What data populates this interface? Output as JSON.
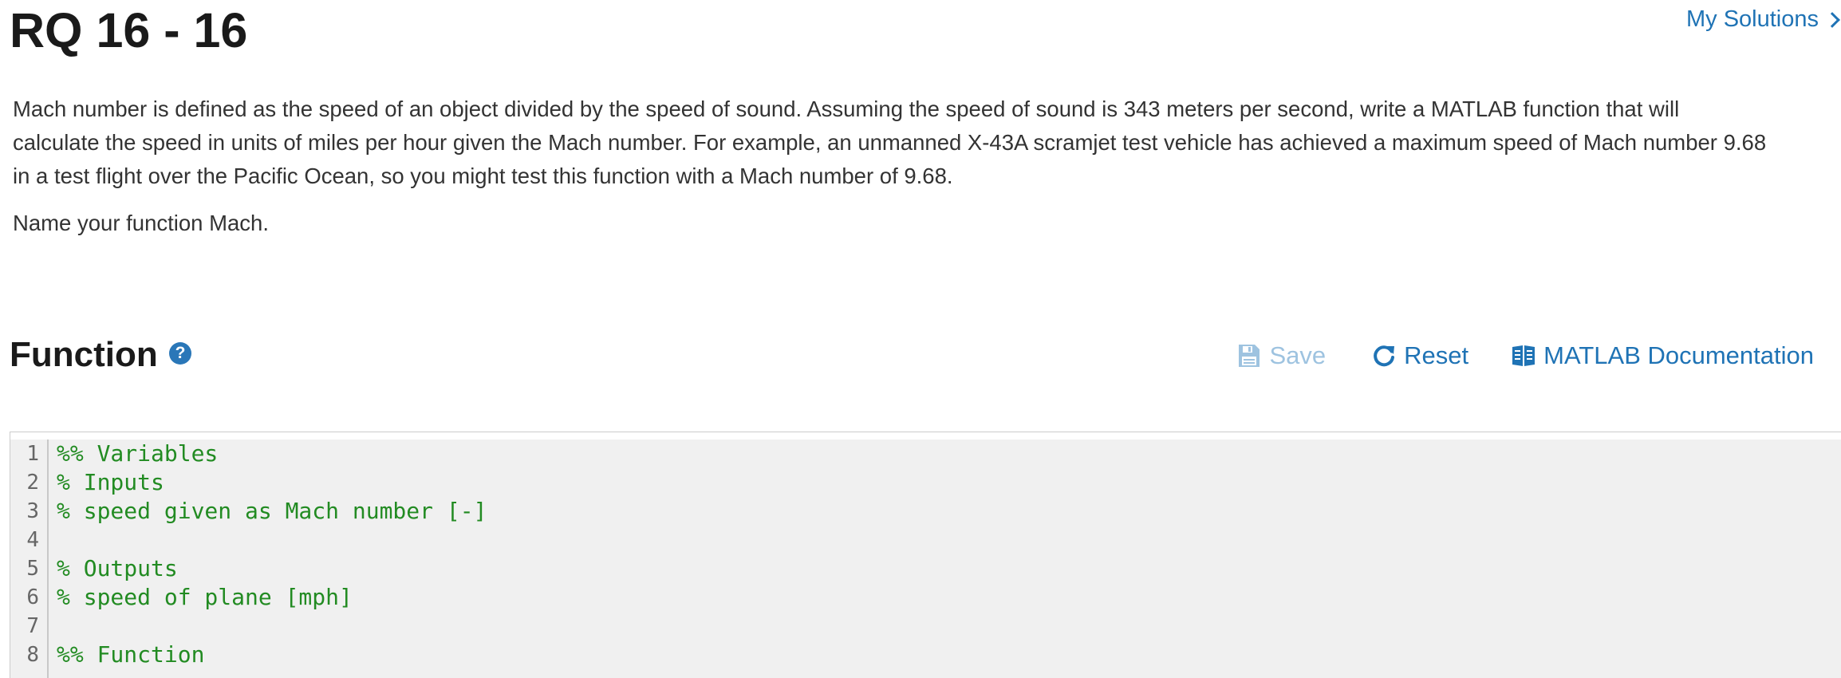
{
  "header": {
    "title": "RQ 16 - 16",
    "my_solutions_label": "My Solutions"
  },
  "problem": {
    "paragraphs": [
      "Mach number is defined as the speed of an object divided by the speed of sound. Assuming the speed of sound is 343 meters per second, write a MATLAB function that will calculate the speed in units of miles per hour given the Mach number. For example, an unmanned X-43A scramjet test vehicle has achieved a maximum speed of Mach number 9.68 in a test flight over the Pacific Ocean, so you might test this function with a Mach number of 9.68.",
      "Name your function Mach."
    ]
  },
  "function_section": {
    "title": "Function",
    "help_glyph": "?",
    "help_icon": "question-circle-icon",
    "toolbar": {
      "save_label": "Save",
      "save_icon": "floppy-disk-icon",
      "reset_label": "Reset",
      "reset_icon": "refresh-icon",
      "docs_label": "MATLAB Documentation",
      "docs_icon": "book-icon"
    }
  },
  "editor": {
    "lines": [
      {
        "num": "1",
        "text": "%% Variables"
      },
      {
        "num": "2",
        "text": "% Inputs"
      },
      {
        "num": "3",
        "text": "% speed given as Mach number [-]"
      },
      {
        "num": "4",
        "text": ""
      },
      {
        "num": "5",
        "text": "% Outputs"
      },
      {
        "num": "6",
        "text": "% speed of plane [mph]"
      },
      {
        "num": "7",
        "text": ""
      },
      {
        "num": "8",
        "text": "%% Function"
      }
    ],
    "comment_color": "#228B22",
    "keyword_color": "#0000FF"
  },
  "colors": {
    "link": "#1F73B5",
    "disabled": "#9EC3E0",
    "help_icon_bg": "#2A77B8"
  }
}
